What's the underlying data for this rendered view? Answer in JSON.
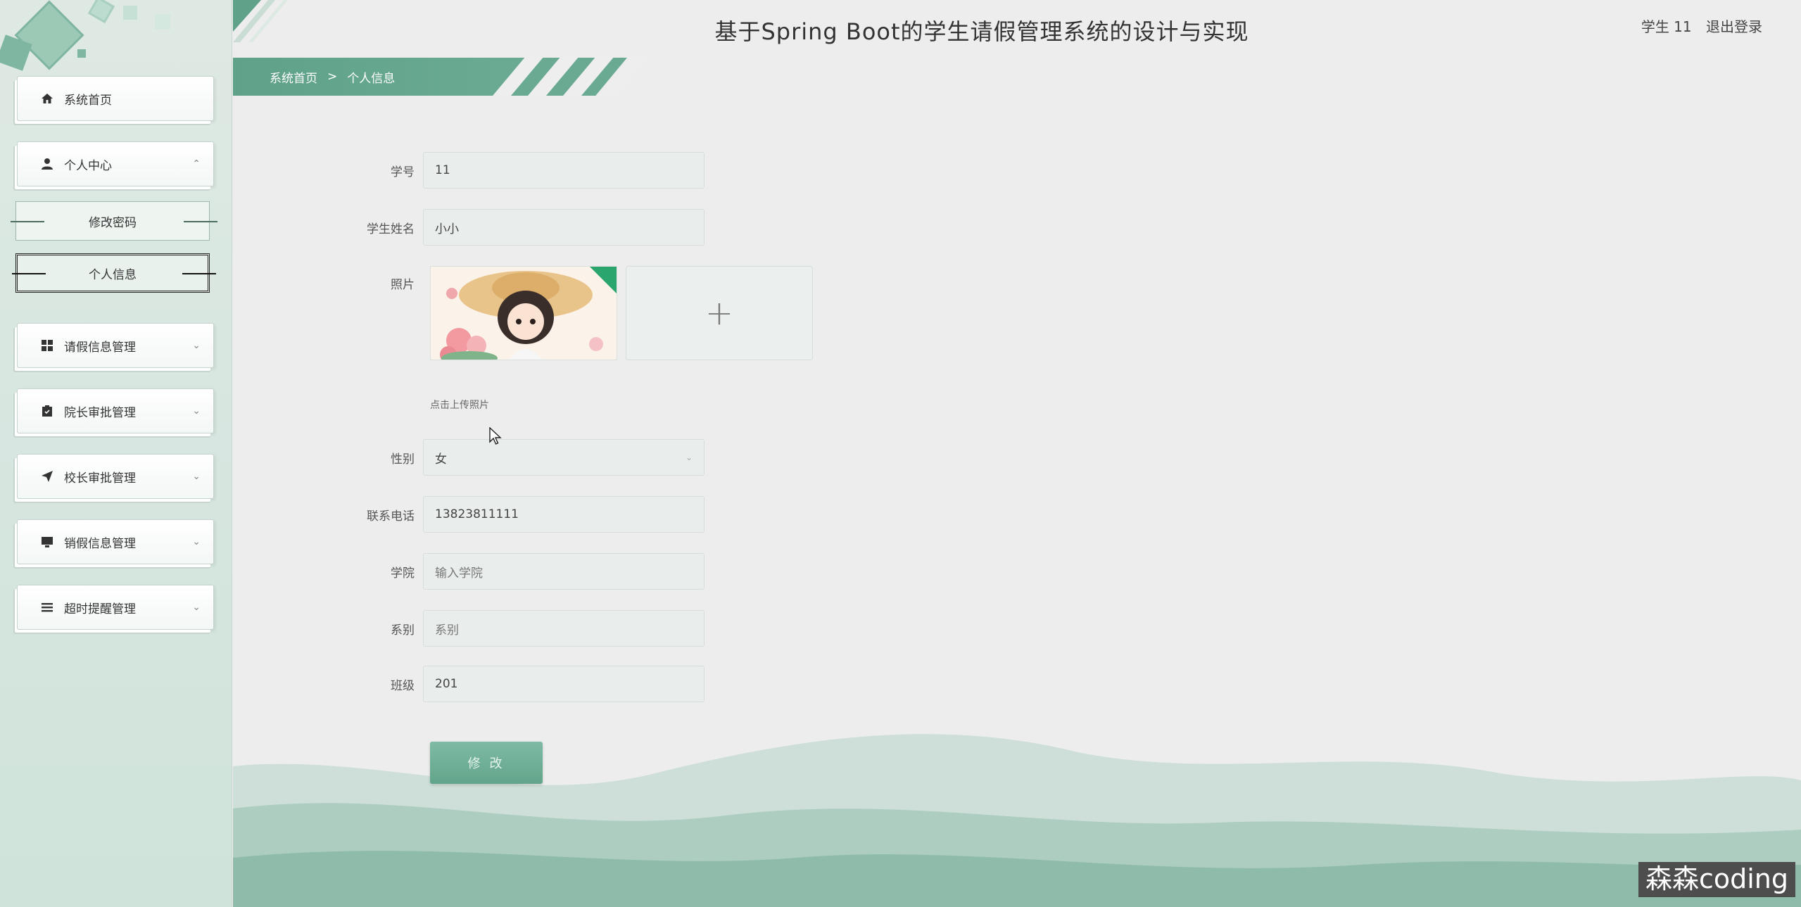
{
  "header": {
    "title": "基于Spring Boot的学生请假管理系统的设计与实现",
    "user_label": "学生 11",
    "logout_label": "退出登录"
  },
  "breadcrumb": {
    "home": "系统首页",
    "separator": ">",
    "current": "个人信息"
  },
  "sidebar": {
    "items": [
      {
        "label": "系统首页",
        "icon": "home-icon"
      },
      {
        "label": "个人中心",
        "icon": "user-icon",
        "expanded": true
      },
      {
        "label": "请假信息管理",
        "icon": "grid-icon"
      },
      {
        "label": "院长审批管理",
        "icon": "clipboard-icon"
      },
      {
        "label": "校长审批管理",
        "icon": "send-icon"
      },
      {
        "label": "销假信息管理",
        "icon": "monitor-icon"
      },
      {
        "label": "超时提醒管理",
        "icon": "list-icon"
      }
    ],
    "sub_items": [
      {
        "label": "修改密码"
      },
      {
        "label": "个人信息",
        "active": true
      }
    ]
  },
  "form": {
    "student_id": {
      "label": "学号",
      "value": "11"
    },
    "student_name": {
      "label": "学生姓名",
      "value": "小小"
    },
    "photo": {
      "label": "照片",
      "hint": "点击上传照片",
      "upload_icon": "plus-icon"
    },
    "gender": {
      "label": "性别",
      "value": "女"
    },
    "phone": {
      "label": "联系电话",
      "value": "13823811111"
    },
    "college": {
      "label": "学院",
      "placeholder": "输入学院"
    },
    "department": {
      "label": "系别",
      "placeholder": "系别"
    },
    "class": {
      "label": "班级",
      "value": "201"
    },
    "submit_label": "修 改"
  },
  "watermark": "森森coding",
  "colors": {
    "accent": "#62a58b",
    "sidebar_bg": "#d6e6df",
    "page_bg": "#ededed"
  }
}
